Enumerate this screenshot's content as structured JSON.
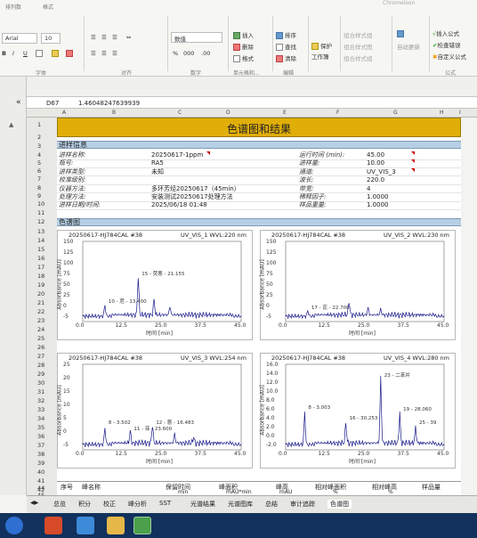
{
  "ribbon": {
    "tabs": [
      "排列数",
      "格式"
    ],
    "window_title": "Chromeleon",
    "font_name": "Arial",
    "font_size": "10",
    "number_format": "数值",
    "buttons": {
      "insert": "插入",
      "delete": "删除",
      "format": "格式",
      "sort": "排序",
      "find": "查找",
      "clear": "清除",
      "protect": "保护",
      "workbook": "工作簿",
      "grp_btn1": "组合样式组",
      "grp_btn2": "组合样式图",
      "grp_btn3": "组合样式组",
      "auto_update": "自动更新",
      "f_insert": "插入公式",
      "f_check": "检查错误",
      "f_custom": "自定义公式"
    },
    "groups": [
      "字体",
      "对齐",
      "数字",
      "单元格和...",
      "编辑",
      "",
      "",
      "公式"
    ]
  },
  "formula_bar": {
    "cell_ref": "D67",
    "value": "1.46048247639939"
  },
  "columns": [
    "A",
    "B",
    "C",
    "D",
    "E",
    "F",
    "G",
    "H",
    "I"
  ],
  "banner": "色谱图和结果",
  "sections": {
    "sample_info": "进样信息",
    "chromatogram": "色谱图"
  },
  "info_left": [
    {
      "label": "进样名称:",
      "value": "20250617-1ppm"
    },
    {
      "label": "瓶号:",
      "value": "RA5"
    },
    {
      "label": "进样类型:",
      "value": "未知"
    },
    {
      "label": "校准级别:",
      "value": ""
    },
    {
      "label": "仪器方法:",
      "value": "多环芳烃20250617（45min）"
    },
    {
      "label": "处理方法:",
      "value": "安装测试20250617处理方法"
    },
    {
      "label": "进样日期/时间:",
      "value": "2025/06/18 01:48"
    }
  ],
  "info_right": [
    {
      "label": "运行时间 (min):",
      "value": "45.00"
    },
    {
      "label": "进样量:",
      "value": "10.00"
    },
    {
      "label": "通道:",
      "value": "UV_VIS_3"
    },
    {
      "label": "波长:",
      "value": "220.0"
    },
    {
      "label": "带宽:",
      "value": "4"
    },
    {
      "label": "稀释因子:",
      "value": "1.0000"
    },
    {
      "label": "样品重量:",
      "value": "1.0000"
    }
  ],
  "charts": [
    {
      "title": "20250617-HJ784CAL #38",
      "channel": "UV_VIS_1 WVL:220 nm",
      "ylabel": "Absorbance [mAU]",
      "xlabel": "时间 [min]",
      "yticks": [
        "150",
        "125",
        "100",
        "75",
        "50",
        "25",
        "0",
        "-5"
      ],
      "xticks": [
        "0.0",
        "12.5",
        "25.0",
        "37.5",
        "45.0"
      ],
      "annotations": [
        "10 - 苊 - 13.400",
        "15 - 荧蒽 - 21.155"
      ]
    },
    {
      "title": "20250617-HJ784CAL #38",
      "channel": "UV_VIS_2 WVL:230 nm",
      "ylabel": "Absorbance [mAU]",
      "xlabel": "时间 [min]",
      "yticks": [
        "150",
        "125",
        "100",
        "75",
        "50",
        "25",
        "0",
        "-5"
      ],
      "xticks": [
        "0.0",
        "12.5",
        "25.0",
        "37.5",
        "45.0"
      ],
      "annotations": [
        "17 - 芘 - 22.700"
      ]
    },
    {
      "title": "20250617-HJ784CAL #38",
      "channel": "UV_VIS_3 WVL:254 nm",
      "ylabel": "Absorbance [mAU]",
      "xlabel": "时间 [min]",
      "yticks": [
        "25",
        "20",
        "15",
        "10",
        "5",
        "0",
        "-5"
      ],
      "xticks": [
        "0.0",
        "12.5",
        "25.0",
        "37.5",
        "45.0"
      ],
      "annotations": [
        "8 - 3.502",
        "11 - 菲 - 23.600",
        "12 - 蒽 - 16.483"
      ]
    },
    {
      "title": "20250617-HJ784CAL #38",
      "channel": "UV_VIS_4 WVL:280 nm",
      "ylabel": "Absorbance [mAU]",
      "xlabel": "时间 [min]",
      "yticks": [
        "16.0",
        "14.0",
        "12.0",
        "10.0",
        "8.0",
        "6.0",
        "4.0",
        "2.0",
        "0.0",
        "-2.0"
      ],
      "xticks": [
        "0.0",
        "12.5",
        "25.0",
        "37.5",
        "45.0"
      ],
      "annotations": [
        "8 - 3.003",
        "16 - 30.253",
        "23 - 二苯并",
        "19 - 28.060",
        "25 - 39"
      ]
    }
  ],
  "table_header": [
    "序号",
    "峰名称",
    "保留时间",
    "峰面积",
    "峰高",
    "相对峰面积",
    "相对峰高",
    "样品量"
  ],
  "table_units": [
    "",
    "",
    "min",
    "mAU*min",
    "mAU",
    "%",
    "%",
    ""
  ],
  "sheet_tabs": [
    "总览",
    "积分",
    "校正",
    "峰分析",
    "SST",
    "光谱结果",
    "光谱图库",
    "总结",
    "审计追踪",
    "色谱图"
  ]
}
